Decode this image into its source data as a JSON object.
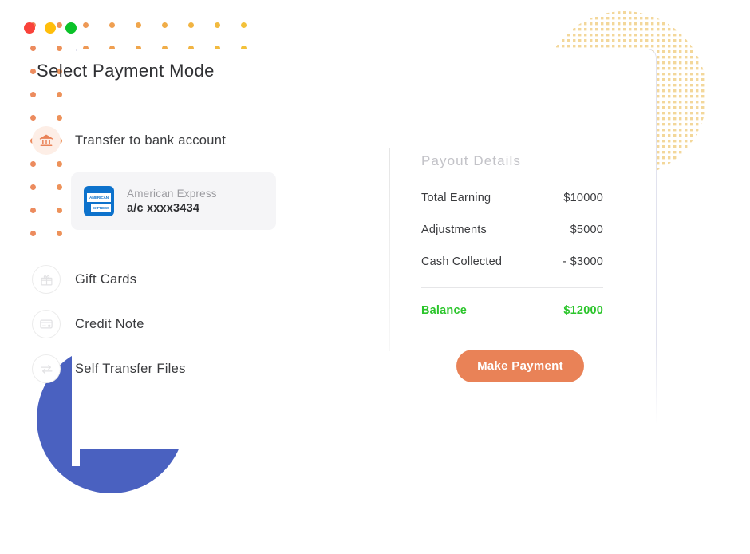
{
  "window": {
    "dots": [
      {
        "name": "close",
        "color": "#f9423a"
      },
      {
        "name": "minimize",
        "color": "#ffbe0b"
      },
      {
        "name": "maximize",
        "color": "#0ac229"
      }
    ]
  },
  "page": {
    "title": "Select Payment Mode"
  },
  "methods": [
    {
      "id": "transfer-to-bank-account",
      "label": "Transfer to bank account",
      "icon": "bank-icon",
      "selected": true
    },
    {
      "id": "gift-cards",
      "label": "Gift Cards",
      "icon": "gift-icon",
      "selected": false
    },
    {
      "id": "credit-note",
      "label": "Credit Note",
      "icon": "credit-card-icon",
      "selected": false
    },
    {
      "id": "self-transfer-files",
      "label": "Self Transfer Files",
      "icon": "transfer-arrows-icon",
      "selected": false
    }
  ],
  "bank_card": {
    "logo": "american-express-logo",
    "logo_line_1": "AMERICAN",
    "logo_line_2": "EXPRESS",
    "brand": "American Express",
    "account": "a/c xxxx3434"
  },
  "payout": {
    "title": "Payout Details",
    "rows": [
      {
        "label": "Total Earning",
        "value": "$10000"
      },
      {
        "label": "Adjustments",
        "value": "$5000"
      },
      {
        "label": "Cash Collected",
        "value": "- $3000"
      }
    ],
    "total": {
      "label": "Balance",
      "value": "$12000"
    }
  },
  "actions": {
    "make_payment_label": "Make Payment"
  },
  "colors": {
    "accent_orange": "#e98257",
    "balance_green": "#2bc52b",
    "decor_blue": "#4a61c0",
    "decor_dot_orange": "#ec8b5e",
    "decor_dot_yellow": "#f3c13a",
    "decor_blob_yellow": "#f6dfa6",
    "amex_blue": "#0d72cc",
    "card_box_bg": "#f5f5f7"
  }
}
